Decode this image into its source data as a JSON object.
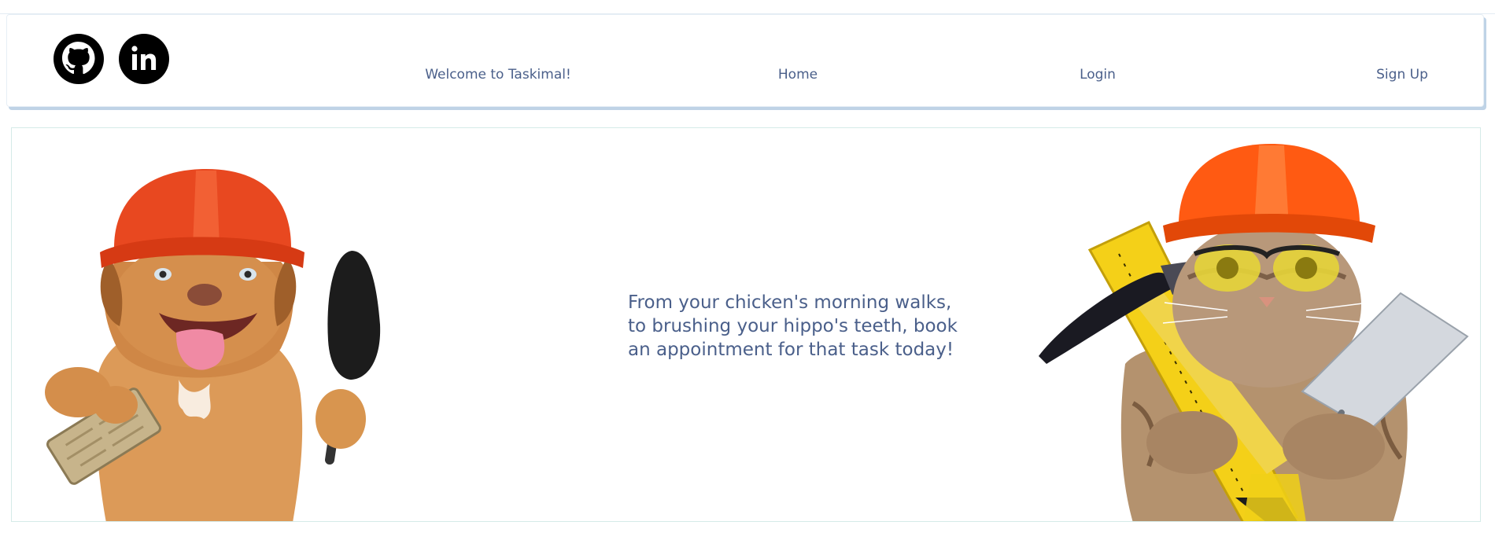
{
  "header": {
    "social": [
      {
        "icon": "github-icon",
        "color": "#000000"
      },
      {
        "icon": "linkedin-icon",
        "color": "#000000"
      }
    ],
    "welcome": "Welcome to Taskimal!",
    "nav": {
      "home": "Home",
      "login": "Login",
      "signup": "Sign Up"
    }
  },
  "hero": {
    "text": "From your chicken's morning walks, to brushing your hippo's teeth, book an appointment for that task today!"
  },
  "colors": {
    "text": "#4a5f8a",
    "navbar_shadow": "#bfd3e6",
    "hero_border": "#d5ebe8"
  }
}
